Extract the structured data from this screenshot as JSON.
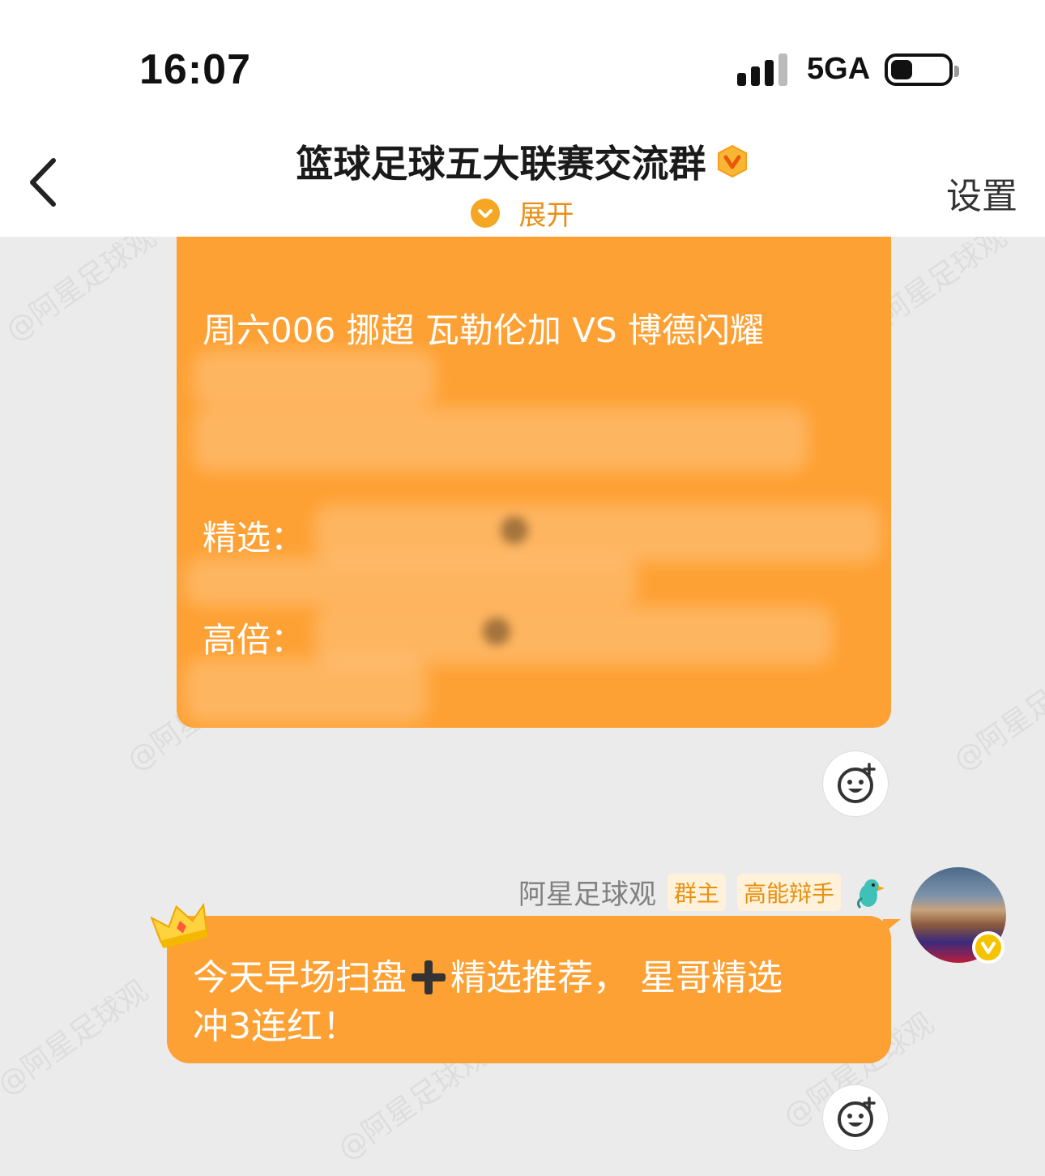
{
  "status_bar": {
    "time": "16:07",
    "network": "5GA"
  },
  "nav": {
    "title": "篮球足球五大联赛交流群",
    "expand_label": "展开",
    "settings_label": "设置"
  },
  "watermark": {
    "text": "@阿星足球观"
  },
  "message1": {
    "line1": "周六006 挪超 瓦勒伦加 VS 博德闪耀",
    "pick_label": "精选：",
    "high_odds_label": "高倍："
  },
  "message2": {
    "sender_name": "阿星足球观",
    "tag_owner": "群主",
    "tag_debater": "高能辩手",
    "text_part1": "今天早场扫盘",
    "text_part2": "精选推荐，  星哥精选",
    "text_line2": "冲3连红！"
  },
  "colors": {
    "bubble": "#fea134",
    "accent": "#f5a623",
    "background": "#ebebeb"
  }
}
